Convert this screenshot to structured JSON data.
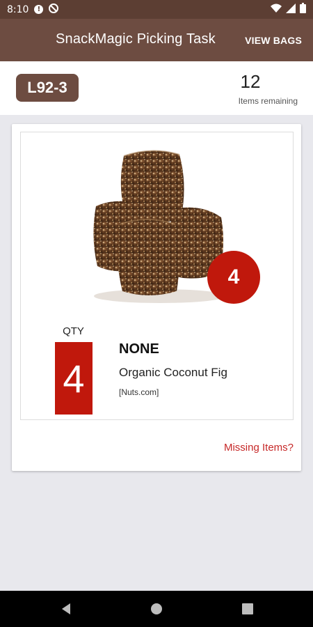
{
  "status_bar": {
    "time": "8:10",
    "icons": [
      "alert-icon",
      "sync-blocked-icon",
      "wifi-icon",
      "signal-icon",
      "battery-icon"
    ]
  },
  "app_bar": {
    "title": "SnackMagic Picking Task",
    "action_label": "VIEW BAGS"
  },
  "header": {
    "location_code": "L92-3",
    "items_remaining_count": "12",
    "items_remaining_label": "Items remaining"
  },
  "item": {
    "qty_label": "QTY",
    "qty_value": "4",
    "badge_qty": "4",
    "variant": "NONE",
    "name": "Organic Coconut Fig",
    "vendor": "[Nuts.com]",
    "image_icon": "coconut-fig-bites-image"
  },
  "card_footer": {
    "missing_items_label": "Missing Items?"
  },
  "nav_bar": {
    "icons": [
      "back-icon",
      "home-icon",
      "recents-icon"
    ]
  },
  "colors": {
    "status_bar": "#5c3e33",
    "app_bar": "#6d4c41",
    "accent_red": "#c0180c",
    "link_red": "#c62828",
    "background": "#e8e8ed"
  }
}
